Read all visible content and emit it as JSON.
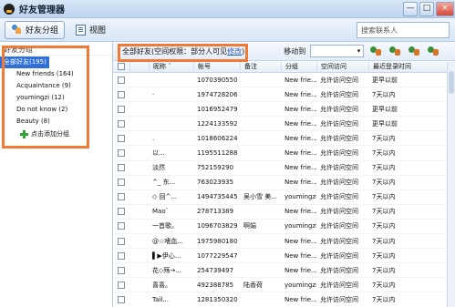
{
  "window": {
    "title": "好友管理器",
    "minimize": "—",
    "maximize": "□",
    "close": "×"
  },
  "toolbar": {
    "friend_groups": "好友分组",
    "view": "视图",
    "search_placeholder": "搜索联系人"
  },
  "groups": {
    "header": "好友分组",
    "items": [
      {
        "label": "全部好友(195)",
        "selected": true
      },
      {
        "label": "New friends (164)"
      },
      {
        "label": "Acquaintance (9)"
      },
      {
        "label": "youmingzi (12)"
      },
      {
        "label": "Do not know (2)"
      },
      {
        "label": "Beauty (8)"
      }
    ],
    "add_group": "点击添加分组"
  },
  "main": {
    "permission_prefix": "全部好友(空间权限：部分人可见",
    "permission_link": "修改",
    "permission_suffix": ")",
    "move_to": "移动到",
    "move_select": "▾"
  },
  "table": {
    "headers": [
      "昵称 ˆ",
      "帐号",
      "备注",
      "分组",
      "空间访问",
      "最近登录时间"
    ],
    "rows": [
      {
        "name": "",
        "account": "1070390550",
        "remark": "",
        "group": "New frie...",
        "access": "允许访问空间",
        "login": "更早以前",
        "avatar": "#f3c34f"
      },
      {
        "name": "·",
        "account": "1974728206",
        "remark": "",
        "group": "New frie...",
        "access": "允许访问空间",
        "login": "7天以内",
        "avatar": "#b78a64"
      },
      {
        "name": "",
        "account": "1016952479",
        "remark": "",
        "group": "New frie...",
        "access": "允许访问空间",
        "login": "更早以前",
        "avatar": "#f18e50"
      },
      {
        "name": "",
        "account": "1224133592",
        "remark": "",
        "group": "New frie...",
        "access": "允许访问空间",
        "login": "更早以前",
        "avatar": "#d8d2b6"
      },
      {
        "name": ".",
        "account": "1018606224",
        "remark": "",
        "group": "New frie...",
        "access": "允许访问空间",
        "login": "7天以内",
        "avatar": "#c9d8e5"
      },
      {
        "name": "以...",
        "account": "1195511288",
        "remark": "",
        "group": "New frie...",
        "access": "允许访问空间",
        "login": "7天以内",
        "avatar": "#eef3f6"
      },
      {
        "name": "淡然",
        "account": "752159290",
        "remark": "",
        "group": "New frie...",
        "access": "允许访问空间",
        "login": "7天以内",
        "avatar": "#c5b0c5"
      },
      {
        "name": "^_ 东...",
        "account": "763023935",
        "remark": "",
        "group": "New frie...",
        "access": "允许访问空间",
        "login": "7天以内",
        "avatar": "#d8bfa3"
      },
      {
        "name": "◇ 回^...",
        "account": "1494735445",
        "remark": "吴小雪 美...",
        "group": "youmingzi",
        "access": "允许访问空间",
        "login": "7天以内",
        "avatar": "#d9b695"
      },
      {
        "name": "Mao`",
        "account": "278713389",
        "remark": "",
        "group": "New frie...",
        "access": "允许访问空间",
        "login": "7天以内",
        "avatar": "#f5f5f5"
      },
      {
        "name": "一首歌。",
        "account": "1096703829",
        "remark": "啊娟",
        "group": "youmingzi",
        "access": "允许访问空间",
        "login": "7天以内",
        "avatar": "#b3a098"
      },
      {
        "name": "@☆嗜血...",
        "account": "1975980180",
        "remark": "",
        "group": "New frie...",
        "access": "允许访问空间",
        "login": "7天以内",
        "avatar": "#c86f7d"
      },
      {
        "name": "▌▶伊心...",
        "account": "1077229547",
        "remark": "",
        "group": "New frie...",
        "access": "允许访问空间",
        "login": "7天以内",
        "avatar": "#2d2624"
      },
      {
        "name": "花◇殇→...",
        "account": "254739497",
        "remark": "",
        "group": "New frie...",
        "access": "允许访问空间",
        "login": "7天以内",
        "avatar": "#eaa4b8"
      },
      {
        "name": "喜喜。",
        "account": "492388785",
        "remark": "陆香荷",
        "group": "youmingzi",
        "access": "允许访问空间",
        "login": "7天以内",
        "avatar": "#a6c2d8"
      },
      {
        "name": "Tail...",
        "account": "1281350320",
        "remark": "",
        "group": "New frie...",
        "access": "允许访问空间",
        "login": "7天以内",
        "avatar": "#bda07e"
      }
    ]
  }
}
